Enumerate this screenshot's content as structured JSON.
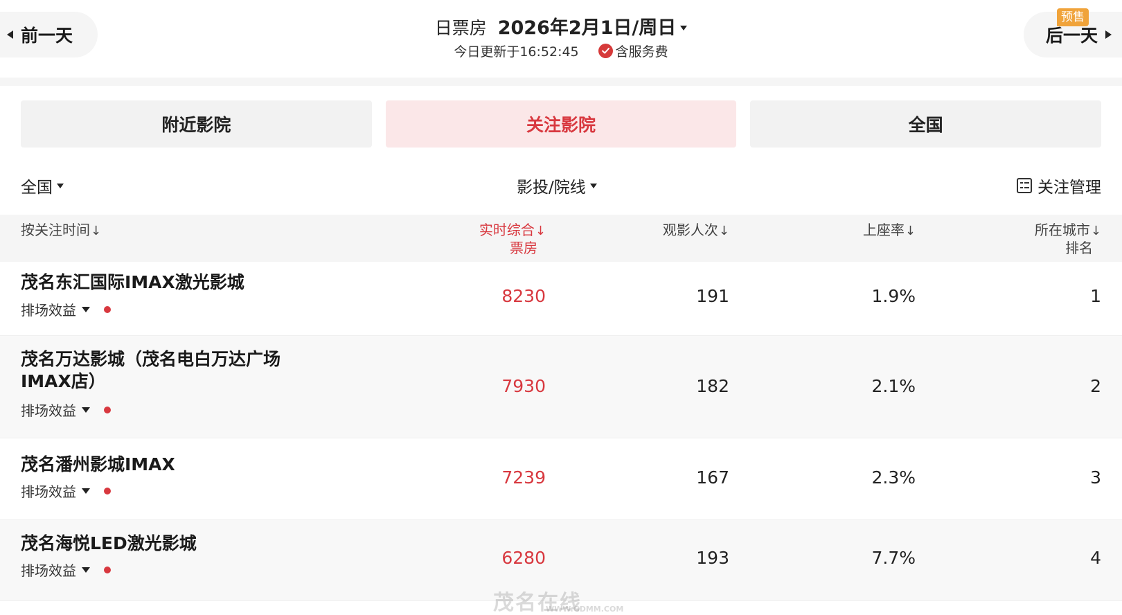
{
  "header": {
    "prev_day": "前一天",
    "next_day": "后一天",
    "presale_badge": "预售",
    "title_label": "日票房",
    "title_date": "2026年2月1日/周日",
    "update_text": "今日更新于16:52:45",
    "service_fee": "含服务费"
  },
  "tabs": [
    {
      "label": "附近影院",
      "active": false
    },
    {
      "label": "关注影院",
      "active": true
    },
    {
      "label": "全国",
      "active": false
    }
  ],
  "filters": {
    "region": "全国",
    "circuit": "影投/院线",
    "manage": "关注管理"
  },
  "table": {
    "sort_label": "按关注时间",
    "columns": {
      "box_office_1": "实时综合",
      "box_office_2": "票房",
      "viewers": "观影人次",
      "seat_rate": "上座率",
      "city_rank_1": "所在城市",
      "city_rank_2": "排名"
    },
    "sort_arrow": "↓",
    "schedule_label": "排场效益",
    "rows": [
      {
        "name": "茂名东汇国际IMAX激光影城",
        "box_office": "8230",
        "viewers": "191",
        "seat_rate": "1.9%",
        "rank": "1"
      },
      {
        "name": "茂名万达影城（茂名电白万达广场IMAX店）",
        "box_office": "7930",
        "viewers": "182",
        "seat_rate": "2.1%",
        "rank": "2"
      },
      {
        "name": "茂名潘州影城IMAX",
        "box_office": "7239",
        "viewers": "167",
        "seat_rate": "2.3%",
        "rank": "3"
      },
      {
        "name": "茂名海悦LED激光影城",
        "box_office": "6280",
        "viewers": "193",
        "seat_rate": "7.7%",
        "rank": "4"
      }
    ]
  },
  "watermark": {
    "text": "茂名在线",
    "url": "WWW.GDMM.COM"
  },
  "colors": {
    "accent": "#d8383f",
    "active_tab_bg": "#fbe7e8",
    "presale": "#f0a33a"
  }
}
